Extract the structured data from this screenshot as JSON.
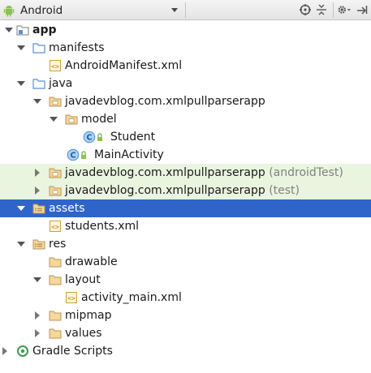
{
  "toolbar": {
    "view_title": "Android",
    "icons": [
      "android-icon",
      "dropdown-caret",
      "locate-icon",
      "collapse-all-icon",
      "gear-icon",
      "hide-icon"
    ]
  },
  "tree": {
    "app": "app",
    "manifests": "manifests",
    "android_manifest": "AndroidManifest.xml",
    "java": "java",
    "pkg_main": "javadevblog.com.xmlpullparserapp",
    "model": "model",
    "student": "Student",
    "main_activity": "MainActivity",
    "pkg_android_test": "javadevblog.com.xmlpullparserapp",
    "pkg_android_test_suffix": "(androidTest)",
    "pkg_test": "javadevblog.com.xmlpullparserapp",
    "pkg_test_suffix": "(test)",
    "assets": "assets",
    "students_xml": "students.xml",
    "res": "res",
    "drawable": "drawable",
    "layout": "layout",
    "activity_main": "activity_main.xml",
    "mipmap": "mipmap",
    "values": "values",
    "gradle_scripts": "Gradle Scripts"
  },
  "colors": {
    "selection": "#2f65ca",
    "test_highlight": "#eaf5e0",
    "folder": "#7a9fc7",
    "class_icon": "#4a8cd6",
    "android_green": "#8bc34a"
  }
}
